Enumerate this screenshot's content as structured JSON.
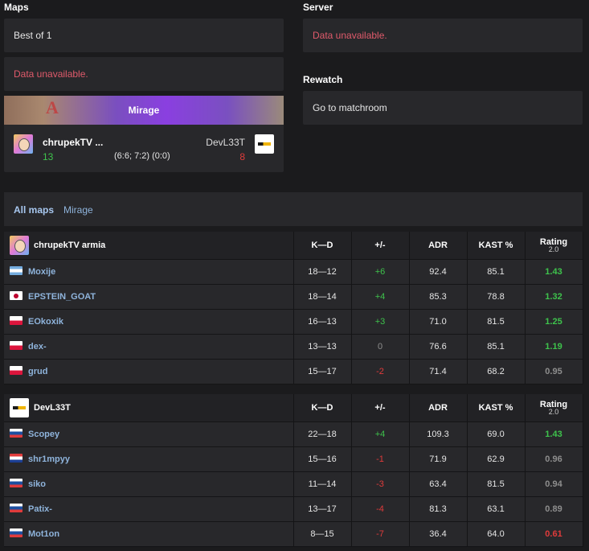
{
  "maps_section": {
    "title": "Maps",
    "format": "Best of 1",
    "veto_status": "Data unavailable."
  },
  "server_section": {
    "title": "Server",
    "status": "Data unavailable."
  },
  "rewatch_section": {
    "title": "Rewatch",
    "link": "Go to matchroom"
  },
  "map_card": {
    "map_name": "Mirage",
    "team1": {
      "name": "chrupekTV ...",
      "score": "13"
    },
    "team2": {
      "name": "DevL33T",
      "score": "8"
    },
    "halves": "(6:6; 7:2) (0:0)"
  },
  "map_tabs": [
    "All maps",
    "Mirage"
  ],
  "stat_headers": {
    "kd": "K—D",
    "plus_minus": "+/-",
    "adr": "ADR",
    "kast": "KAST %",
    "rating": "Rating",
    "rating_version": "2.0"
  },
  "colors": {
    "positive": "#3ec34c",
    "negative": "#e03b3b",
    "neutral": "#8e8e8e",
    "link": "#8fb4dc",
    "error": "#e05a6b"
  },
  "teams": [
    {
      "name": "chrupekTV armia",
      "logo_icon": "chrupek-avatar-icon",
      "players": [
        {
          "flag": "ar",
          "name": "Moxije",
          "kd": "18—12",
          "pm": "+6",
          "pm_type": "positive",
          "adr": "92.4",
          "kast": "85.1",
          "rating": "1.43",
          "rating_type": "positive"
        },
        {
          "flag": "jp",
          "name": "EPSTEIN_GOAT",
          "kd": "18—14",
          "pm": "+4",
          "pm_type": "positive",
          "adr": "85.3",
          "kast": "78.8",
          "rating": "1.32",
          "rating_type": "positive"
        },
        {
          "flag": "pl",
          "name": "EOkoxik",
          "kd": "16—13",
          "pm": "+3",
          "pm_type": "positive",
          "adr": "71.0",
          "kast": "81.5",
          "rating": "1.25",
          "rating_type": "positive"
        },
        {
          "flag": "pl",
          "name": "dex-",
          "kd": "13—13",
          "pm": "0",
          "pm_type": "neutral",
          "adr": "76.6",
          "kast": "85.1",
          "rating": "1.19",
          "rating_type": "positive"
        },
        {
          "flag": "pl",
          "name": "grud",
          "kd": "15—17",
          "pm": "-2",
          "pm_type": "negative",
          "adr": "71.4",
          "kast": "68.2",
          "rating": "0.95",
          "rating_type": "neutral"
        }
      ]
    },
    {
      "name": "DevL33T",
      "logo_icon": "devl33t-logo-icon",
      "players": [
        {
          "flag": "si",
          "name": "Scopey",
          "kd": "22—18",
          "pm": "+4",
          "pm_type": "positive",
          "adr": "109.3",
          "kast": "69.0",
          "rating": "1.43",
          "rating_type": "positive"
        },
        {
          "flag": "hr",
          "name": "shr1mpyy",
          "kd": "15—16",
          "pm": "-1",
          "pm_type": "negative",
          "adr": "71.9",
          "kast": "62.9",
          "rating": "0.96",
          "rating_type": "neutral"
        },
        {
          "flag": "si",
          "name": "siko",
          "kd": "11—14",
          "pm": "-3",
          "pm_type": "negative",
          "adr": "63.4",
          "kast": "81.5",
          "rating": "0.94",
          "rating_type": "neutral"
        },
        {
          "flag": "si",
          "name": "Patix-",
          "kd": "13—17",
          "pm": "-4",
          "pm_type": "negative",
          "adr": "81.3",
          "kast": "63.1",
          "rating": "0.89",
          "rating_type": "neutral"
        },
        {
          "flag": "si",
          "name": "Mot1on",
          "kd": "8—15",
          "pm": "-7",
          "pm_type": "negative",
          "adr": "36.4",
          "kast": "64.0",
          "rating": "0.61",
          "rating_type": "negative"
        }
      ]
    }
  ]
}
